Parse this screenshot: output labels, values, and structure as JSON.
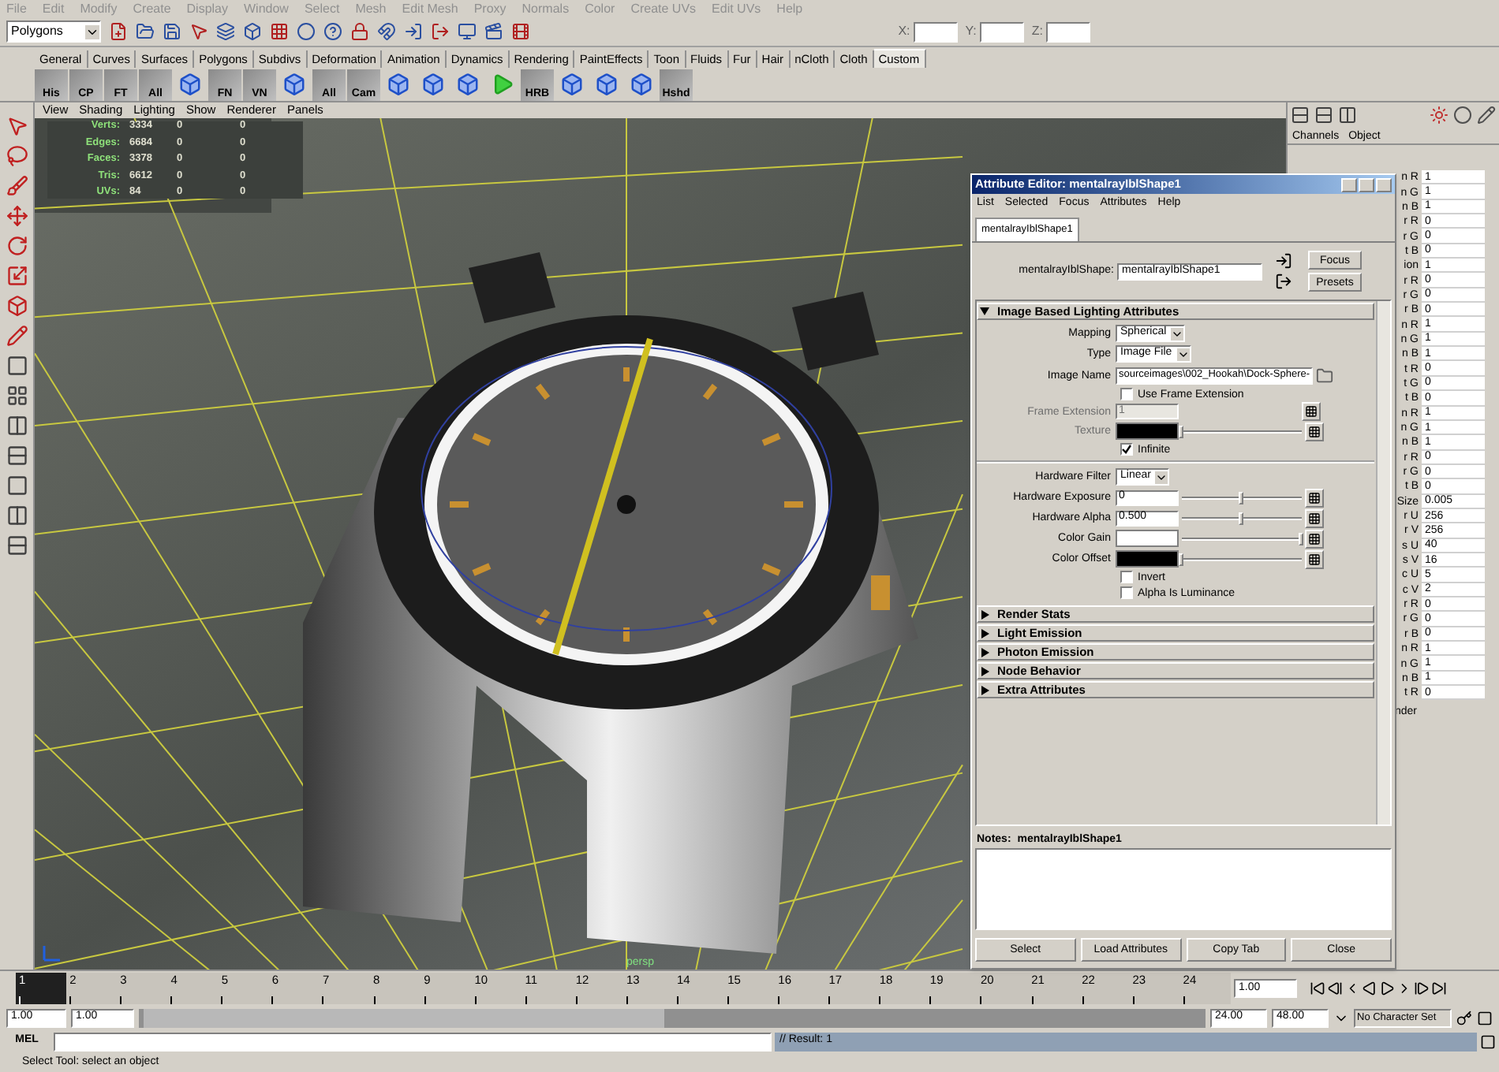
{
  "menu_bar": [
    "File",
    "Edit",
    "Modify",
    "Create",
    "Display",
    "Window",
    "Select",
    "Mesh",
    "Edit Mesh",
    "Proxy",
    "Normals",
    "Color",
    "Create UVs",
    "Edit UVs",
    "Help"
  ],
  "status_line": {
    "mode": "Polygons",
    "x_label": "X:",
    "y_label": "Y:",
    "z_label": "Z:"
  },
  "shelf_tabs": [
    {
      "label": "General",
      "selected": false
    },
    {
      "label": "Curves",
      "selected": false
    },
    {
      "label": "Surfaces",
      "selected": false
    },
    {
      "label": "Polygons",
      "selected": false
    },
    {
      "label": "Subdivs",
      "selected": false
    },
    {
      "label": "Deformation",
      "selected": false
    },
    {
      "label": "Animation",
      "selected": false
    },
    {
      "label": "Dynamics",
      "selected": false
    },
    {
      "label": "Rendering",
      "selected": false
    },
    {
      "label": "PaintEffects",
      "selected": false
    },
    {
      "label": "Toon",
      "selected": false
    },
    {
      "label": "Fluids",
      "selected": false
    },
    {
      "label": "Fur",
      "selected": false
    },
    {
      "label": "Hair",
      "selected": false
    },
    {
      "label": "nCloth",
      "selected": false
    },
    {
      "label": "Cloth",
      "selected": false
    },
    {
      "label": "Custom",
      "selected": true
    }
  ],
  "shelf": [
    {
      "kind": "labeled",
      "label": "His"
    },
    {
      "kind": "labeled",
      "label": "CP"
    },
    {
      "kind": "labeled",
      "label": "FT"
    },
    {
      "kind": "labeled",
      "label": "All"
    },
    {
      "kind": "icon"
    },
    {
      "kind": "labeled",
      "label": "FN"
    },
    {
      "kind": "labeled",
      "label": "VN"
    },
    {
      "kind": "icon"
    },
    {
      "kind": "labeled",
      "label": "All"
    },
    {
      "kind": "labeled",
      "label": "Cam"
    },
    {
      "kind": "icon"
    },
    {
      "kind": "icon"
    },
    {
      "kind": "icon"
    },
    {
      "kind": "play"
    },
    {
      "kind": "labeled",
      "label": "HRB"
    },
    {
      "kind": "icon"
    },
    {
      "kind": "icon"
    },
    {
      "kind": "icon"
    },
    {
      "kind": "labeled",
      "label": "Hshd"
    }
  ],
  "viewport": {
    "menus": [
      "View",
      "Shading",
      "Lighting",
      "Show",
      "Renderer",
      "Panels"
    ],
    "hud": [
      {
        "label": "Verts:",
        "values": [
          "3334",
          "0",
          "0"
        ]
      },
      {
        "label": "Edges:",
        "values": [
          "6684",
          "0",
          "0"
        ]
      },
      {
        "label": "Faces:",
        "values": [
          "3378",
          "0",
          "0"
        ]
      },
      {
        "label": "Tris:",
        "values": [
          "6612",
          "0",
          "0"
        ]
      },
      {
        "label": "UVs:",
        "values": [
          "84",
          "0",
          "0"
        ]
      }
    ],
    "camera": "persp"
  },
  "channel_box": {
    "menus": [
      "Channels",
      "Object"
    ],
    "rows": [
      {
        "label": "n R",
        "value": "1"
      },
      {
        "label": "n G",
        "value": "1"
      },
      {
        "label": "n B",
        "value": "1"
      },
      {
        "label": "r R",
        "value": "0"
      },
      {
        "label": "r G",
        "value": "0"
      },
      {
        "label": "t B",
        "value": "0"
      },
      {
        "label": "ion",
        "value": "1"
      },
      {
        "label": "r R",
        "value": "0"
      },
      {
        "label": "r G",
        "value": "0"
      },
      {
        "label": "r B",
        "value": "0"
      },
      {
        "label": "n R",
        "value": "1"
      },
      {
        "label": "n G",
        "value": "1"
      },
      {
        "label": "n B",
        "value": "1"
      },
      {
        "label": "t R",
        "value": "0"
      },
      {
        "label": "t G",
        "value": "0"
      },
      {
        "label": "t B",
        "value": "0"
      },
      {
        "label": "n R",
        "value": "1"
      },
      {
        "label": "n G",
        "value": "1"
      },
      {
        "label": "n B",
        "value": "1"
      },
      {
        "label": "r R",
        "value": "0"
      },
      {
        "label": "r G",
        "value": "0"
      },
      {
        "label": "t B",
        "value": "0"
      },
      {
        "label": "Size",
        "value": "0.005"
      },
      {
        "label": "r U",
        "value": "256"
      },
      {
        "label": "r V",
        "value": "256"
      },
      {
        "label": "s U",
        "value": "40"
      },
      {
        "label": "s V",
        "value": "16"
      },
      {
        "label": "c U",
        "value": "5"
      },
      {
        "label": "c V",
        "value": "2"
      },
      {
        "label": "r R",
        "value": "0"
      },
      {
        "label": "r G",
        "value": "0"
      },
      {
        "label": "r B",
        "value": "0"
      },
      {
        "label": "n R",
        "value": "1"
      },
      {
        "label": "n G",
        "value": "1"
      },
      {
        "label": "n B",
        "value": "1"
      },
      {
        "label": "t R",
        "value": "0"
      }
    ],
    "footer": "nder"
  },
  "attribute_editor": {
    "title": "Attribute Editor: mentalrayIblShape1",
    "menus": [
      "List",
      "Selected",
      "Focus",
      "Attributes",
      "Help"
    ],
    "tab": {
      "label": "mentalrayIblShape1",
      "selected": true
    },
    "node_label": "mentalrayIblShape:",
    "node_name": "mentalrayIblShape1",
    "side_buttons": [
      "Focus",
      "Presets"
    ],
    "sections": [
      {
        "title": "Image Based Lighting Attributes",
        "expanded": true,
        "rows": [
          {
            "kind": "dropdown",
            "label": "Mapping",
            "value": "Spherical"
          },
          {
            "kind": "dropdown",
            "label": "Type",
            "value": "Image File"
          },
          {
            "kind": "file",
            "label": "Image Name",
            "value": "sourceimages\\002_Hookah\\Dock-Sphere-"
          },
          {
            "kind": "checkbox",
            "label": "Use Frame Extension",
            "checked": false
          },
          {
            "kind": "field",
            "label": "Frame Extension",
            "value": "1",
            "disabled": true
          },
          {
            "kind": "color",
            "label": "Texture",
            "color": "#000000",
            "level": 0.0,
            "disabled": true
          },
          {
            "kind": "checkbox",
            "label": "Infinite",
            "checked": true
          },
          {
            "kind": "divider"
          },
          {
            "kind": "dropdown",
            "label": "Hardware Filter",
            "value": "Linear"
          },
          {
            "kind": "slider",
            "label": "Hardware Exposure",
            "value": "0",
            "level": 0.5,
            "disabled": false
          },
          {
            "kind": "slider",
            "label": "Hardware Alpha",
            "value": "0.500",
            "level": 0.5,
            "disabled": false
          },
          {
            "kind": "color",
            "label": "Color Gain",
            "color": "#ffffff",
            "level": 1.0,
            "disabled": false
          },
          {
            "kind": "color",
            "label": "Color Offset",
            "color": "#000000",
            "level": 0.0,
            "disabled": false
          },
          {
            "kind": "checkbox",
            "label": "Invert",
            "checked": false
          },
          {
            "kind": "checkbox",
            "label": "Alpha Is Luminance",
            "checked": false
          }
        ]
      },
      {
        "title": "Render Stats",
        "expanded": false
      },
      {
        "title": "Light Emission",
        "expanded": false
      },
      {
        "title": "Photon Emission",
        "expanded": false
      },
      {
        "title": "Node Behavior",
        "expanded": false
      },
      {
        "title": "Extra Attributes",
        "expanded": false
      }
    ],
    "notes_label": "Notes:",
    "notes_node": "mentalrayIblShape1",
    "buttons": [
      "Select",
      "Load Attributes",
      "Copy Tab",
      "Close"
    ]
  },
  "timeline": {
    "frames": [
      {
        "label": "1",
        "selected": true
      },
      {
        "label": "2",
        "selected": false
      },
      {
        "label": "3",
        "selected": false
      },
      {
        "label": "4",
        "selected": false
      },
      {
        "label": "5",
        "selected": false
      },
      {
        "label": "6",
        "selected": false
      },
      {
        "label": "7",
        "selected": false
      },
      {
        "label": "8",
        "selected": false
      },
      {
        "label": "9",
        "selected": false
      },
      {
        "label": "10",
        "selected": false
      },
      {
        "label": "11",
        "selected": false
      },
      {
        "label": "12",
        "selected": false
      },
      {
        "label": "13",
        "selected": false
      },
      {
        "label": "14",
        "selected": false
      },
      {
        "label": "15",
        "selected": false
      },
      {
        "label": "16",
        "selected": false
      },
      {
        "label": "17",
        "selected": false
      },
      {
        "label": "18",
        "selected": false
      },
      {
        "label": "19",
        "selected": false
      },
      {
        "label": "20",
        "selected": false
      },
      {
        "label": "21",
        "selected": false
      },
      {
        "label": "22",
        "selected": false
      },
      {
        "label": "23",
        "selected": false
      },
      {
        "label": "24",
        "selected": false
      }
    ],
    "current_frame": "1.00"
  },
  "range": {
    "start": "1.00",
    "playback_start": "1.00",
    "playback_end": "24.00",
    "end": "48.00",
    "character_set": "No Character Set"
  },
  "command_line": {
    "label": "MEL",
    "result": "// Result: 1"
  },
  "help_line": "Select Tool: select an object"
}
